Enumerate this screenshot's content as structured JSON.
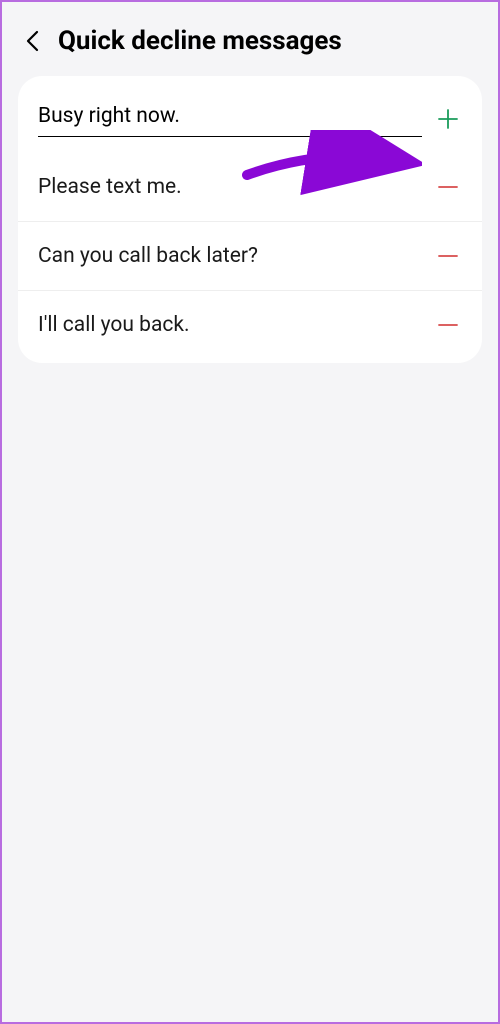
{
  "header": {
    "title": "Quick decline messages"
  },
  "input": {
    "value": "Busy right now."
  },
  "messages": [
    {
      "text": "Please text me."
    },
    {
      "text": "Can you call back later?"
    },
    {
      "text": "I'll call you back."
    }
  ],
  "colors": {
    "add": "#1a9c5b",
    "remove": "#d84b4b",
    "arrow": "#8a08d6"
  }
}
